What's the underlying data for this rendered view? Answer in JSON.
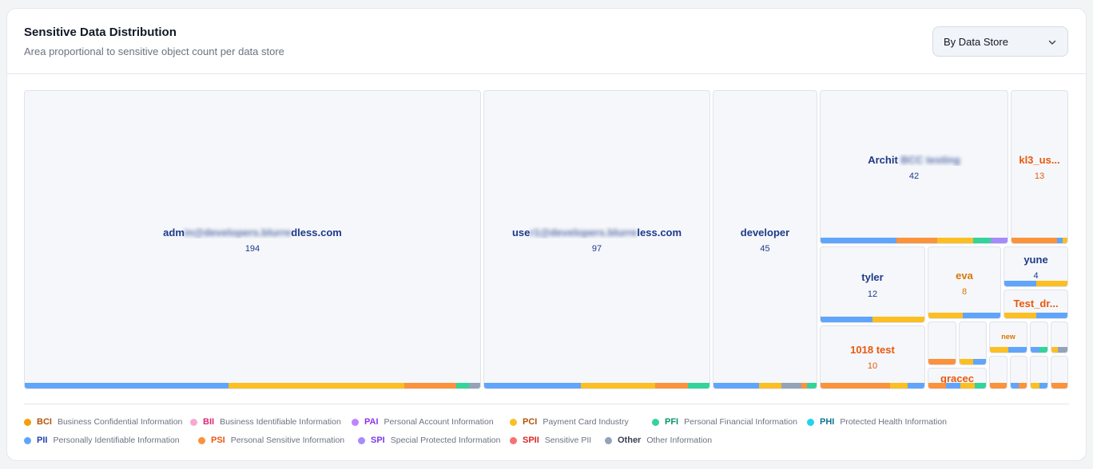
{
  "header": {
    "title": "Sensitive Data Distribution",
    "subtitle": "Area proportional to sensitive object count per data store"
  },
  "group_select": {
    "selected": "By Data Store",
    "icon": "chevron-down-icon"
  },
  "colors": {
    "BCI": "#f59e0b",
    "BII": "#f9a8d4",
    "PAI": "#c084fc",
    "PCI": "#fbbf24",
    "PFI": "#34d399",
    "PHI": "#22d3ee",
    "PII": "#60a5fa",
    "PSI": "#fb923c",
    "SPI": "#a78bfa",
    "SPII": "#f87171",
    "Other": "#94a3b8"
  },
  "legend": [
    [
      {
        "code": "BCI",
        "desc": "Business Confidential Information",
        "color": "#f59e0b",
        "text_color": "#b45309"
      },
      {
        "code": "BII",
        "desc": "Business Identifiable Information",
        "color": "#f9a8d4",
        "text_color": "#db2777"
      },
      {
        "code": "PAI",
        "desc": "Personal Account Information",
        "color": "#c084fc",
        "text_color": "#9333ea"
      },
      {
        "code": "PCI",
        "desc": "Payment Card Industry",
        "color": "#fbbf24",
        "text_color": "#b45309"
      },
      {
        "code": "PFI",
        "desc": "Personal Financial Information",
        "color": "#34d399",
        "text_color": "#059669"
      },
      {
        "code": "PHI",
        "desc": "Protected Health Information",
        "color": "#22d3ee",
        "text_color": "#0e7490"
      }
    ],
    [
      {
        "code": "PII",
        "desc": "Personally Identifiable Information",
        "color": "#60a5fa",
        "text_color": "#1e40af"
      },
      {
        "code": "PSI",
        "desc": "Personal Sensitive Information",
        "color": "#fb923c",
        "text_color": "#ea580c"
      },
      {
        "code": "SPI",
        "desc": "Special Protected Information",
        "color": "#a78bfa",
        "text_color": "#7c3aed"
      },
      {
        "code": "SPII",
        "desc": "Sensitive PII",
        "color": "#f87171",
        "text_color": "#dc2626"
      },
      {
        "code": "Other",
        "desc": "Other Information",
        "color": "#94a3b8",
        "text_color": "#374151"
      }
    ]
  ],
  "chart_data": {
    "type": "treemap",
    "title": "Sensitive Data Distribution",
    "subtitle": "Area proportional to sensitive object count per data store",
    "items": [
      {
        "name_start": "adm",
        "name_hidden": "in@developers.blurre",
        "name_end": "dless.com",
        "count": 194,
        "text_color": "#1e3a8a",
        "segments": [
          {
            "code": "PII",
            "share": 0.447
          },
          {
            "code": "PCI",
            "share": 0.386
          },
          {
            "code": "PSI",
            "share": 0.114
          },
          {
            "code": "PFI",
            "share": 0.029
          },
          {
            "code": "Other",
            "share": 0.024
          }
        ]
      },
      {
        "name_start": "use",
        "name_hidden": "r1@developers.blurre",
        "name_end": "less.com",
        "count": 97,
        "text_color": "#1e3a8a",
        "segments": [
          {
            "code": "PII",
            "share": 0.43
          },
          {
            "code": "PCI",
            "share": 0.33
          },
          {
            "code": "PSI",
            "share": 0.145
          },
          {
            "code": "PFI",
            "share": 0.095
          }
        ]
      },
      {
        "name": "developer",
        "count": 45,
        "text_color": "#1e3a8a",
        "segments": [
          {
            "code": "PII",
            "share": 0.44
          },
          {
            "code": "PCI",
            "share": 0.22
          },
          {
            "code": "Other",
            "share": 0.19
          },
          {
            "code": "PSI",
            "share": 0.06
          },
          {
            "code": "PFI",
            "share": 0.09
          }
        ]
      },
      {
        "name_start": "Archit",
        "name_hidden": " BCC testing",
        "name_end": "",
        "count": 42,
        "text_color": "#1e3a8a",
        "segments": [
          {
            "code": "PII",
            "share": 0.405
          },
          {
            "code": "PSI",
            "share": 0.22
          },
          {
            "code": "PCI",
            "share": 0.19
          },
          {
            "code": "PFI",
            "share": 0.095
          },
          {
            "code": "SPI",
            "share": 0.09
          }
        ]
      },
      {
        "name": "kl3_us...",
        "count": 13,
        "text_color": "#ea580c",
        "segments": [
          {
            "code": "PSI",
            "share": 0.82
          },
          {
            "code": "PII",
            "share": 0.1
          },
          {
            "code": "PCI",
            "share": 0.08
          }
        ]
      },
      {
        "name": "tyler",
        "count": 12,
        "text_color": "#1e3a8a",
        "segments": [
          {
            "code": "PII",
            "share": 0.5
          },
          {
            "code": "PCI",
            "share": 0.5
          }
        ]
      },
      {
        "name": "eva",
        "count": 8,
        "text_color": "#d97706",
        "segments": [
          {
            "code": "PCI",
            "share": 0.48
          },
          {
            "code": "PII",
            "share": 0.52
          }
        ]
      },
      {
        "name": "yune",
        "count": 4,
        "text_color": "#1e3a8a",
        "segments": [
          {
            "code": "PII",
            "share": 0.5
          },
          {
            "code": "PCI",
            "share": 0.5
          }
        ]
      },
      {
        "name": "Test_dr...",
        "count": null,
        "text_color": "#ea580c",
        "segments": [
          {
            "code": "PCI",
            "share": 0.5
          },
          {
            "code": "PII",
            "share": 0.5
          }
        ]
      },
      {
        "name": "1018 test",
        "count": 10,
        "text_color": "#ea580c",
        "segments": [
          {
            "code": "PSI",
            "share": 0.67
          },
          {
            "code": "PCI",
            "share": 0.17
          },
          {
            "code": "PII",
            "share": 0.16
          }
        ]
      },
      {
        "name": "",
        "count": null,
        "segments": [
          {
            "code": "PSI",
            "share": 1.0
          }
        ]
      },
      {
        "name": "",
        "count": null,
        "segments": [
          {
            "code": "PCI",
            "share": 0.5
          },
          {
            "code": "PII",
            "share": 0.5
          }
        ]
      },
      {
        "name": "new",
        "count": null,
        "text_color": "#d97706",
        "segments": [
          {
            "code": "PCI",
            "share": 0.5
          },
          {
            "code": "PII",
            "share": 0.5
          }
        ]
      },
      {
        "name": "",
        "count": null,
        "segments": [
          {
            "code": "PII",
            "share": 0.5
          },
          {
            "code": "PFI",
            "share": 0.5
          }
        ]
      },
      {
        "name": "",
        "count": null,
        "segments": [
          {
            "code": "PCI",
            "share": 0.4
          },
          {
            "code": "Other",
            "share": 0.6
          }
        ]
      },
      {
        "name": "gracec",
        "count": null,
        "text_color": "#ea580c",
        "segments": [
          {
            "code": "PSI",
            "share": 0.3
          },
          {
            "code": "PII",
            "share": 0.25
          },
          {
            "code": "PCI",
            "share": 0.25
          },
          {
            "code": "PFI",
            "share": 0.2
          }
        ]
      },
      {
        "name": "",
        "count": null,
        "segments": [
          {
            "code": "PSI",
            "share": 1.0
          }
        ]
      },
      {
        "name": "",
        "count": null,
        "segments": [
          {
            "code": "PII",
            "share": 0.5
          },
          {
            "code": "PSI",
            "share": 0.5
          }
        ]
      },
      {
        "name": "",
        "count": null,
        "segments": [
          {
            "code": "PCI",
            "share": 0.5
          },
          {
            "code": "PII",
            "share": 0.5
          }
        ]
      },
      {
        "name": "",
        "count": null,
        "segments": [
          {
            "code": "PSI",
            "share": 1.0
          }
        ]
      }
    ]
  }
}
